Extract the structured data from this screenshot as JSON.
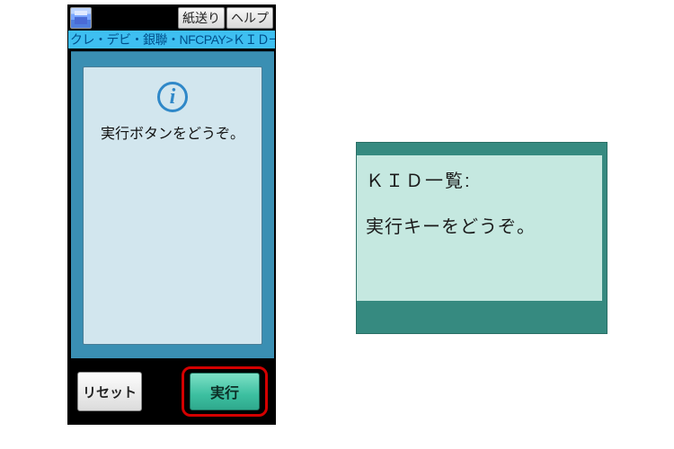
{
  "terminal": {
    "topbar": {
      "paper_feed_label": "紙送り",
      "help_label": "ヘルプ"
    },
    "path_text": "クレ・デビ・銀聯・NFCPAY>ＫＩＤ一覧",
    "info": {
      "icon_glyph": "i",
      "message": "実行ボタンをどうぞ。"
    },
    "buttons": {
      "reset_label": "リセット",
      "exec_label": "実行"
    }
  },
  "display": {
    "title": "ＫＩＤ一覧:",
    "message": "実行キーをどうぞ。"
  }
}
